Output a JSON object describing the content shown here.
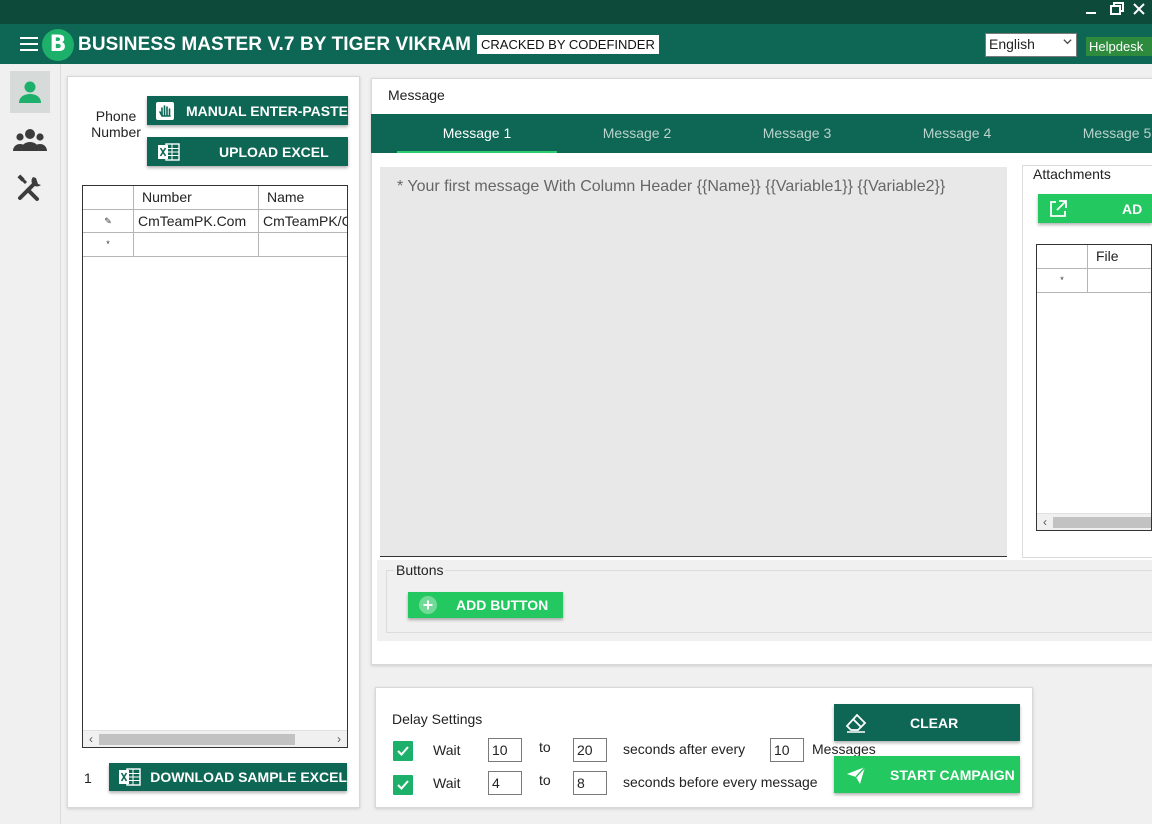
{
  "window": {
    "title": "BUSINESS MASTER V.7 BY TIGER VIKRAM",
    "badge": "CRACKED BY CODEFINDER",
    "language": "English",
    "helpdesk": "Helpdesk",
    "logo_letter": "B",
    "controls": [
      "minimize-icon",
      "restore-icon",
      "close-icon"
    ]
  },
  "nav": {
    "items": [
      {
        "icon": "person-icon",
        "active": true
      },
      {
        "icon": "group-icon",
        "active": false
      },
      {
        "icon": "tools-icon",
        "active": false
      }
    ]
  },
  "contacts": {
    "phone_label": "Phone Number",
    "manual_button": "MANUAL ENTER-PASTE",
    "upload_button": "UPLOAD EXCEL",
    "columns": [
      "Number",
      "Name"
    ],
    "rows": [
      {
        "marker": "✎",
        "number": "CmTeamPK.Com",
        "name": "CmTeamPK/C"
      },
      {
        "marker": "*",
        "number": "",
        "name": ""
      }
    ],
    "row_count": "1",
    "download_button": "DOWNLOAD SAMPLE EXCEL"
  },
  "message": {
    "header": "Message",
    "tabs": [
      "Message 1",
      "Message 2",
      "Message 3",
      "Message 4",
      "Message 5"
    ],
    "active_tab": 0,
    "placeholder": "* Your first message With Column Header {{Name}} {{Variable1}} {{Variable2}}",
    "attachments_label": "Attachments",
    "add_attachment_button": "AD",
    "file_column": "File",
    "file_row_marker": "*",
    "buttons_label": "Buttons",
    "add_button": "ADD BUTTON"
  },
  "delay": {
    "label": "Delay Settings",
    "row1": {
      "checked": true,
      "wait": "Wait",
      "from": "10",
      "to_word": "to",
      "to": "20",
      "text": "seconds after every",
      "count": "10",
      "unit": "Messages"
    },
    "row2": {
      "checked": true,
      "wait": "Wait",
      "from": "4",
      "to_word": "to",
      "to": "8",
      "text": "seconds before every message"
    },
    "clear_button": "CLEAR",
    "start_button": "START CAMPAIGN"
  },
  "colors": {
    "header": "#0e6655",
    "accent": "#24c860",
    "dark_button": "#0e6655"
  }
}
